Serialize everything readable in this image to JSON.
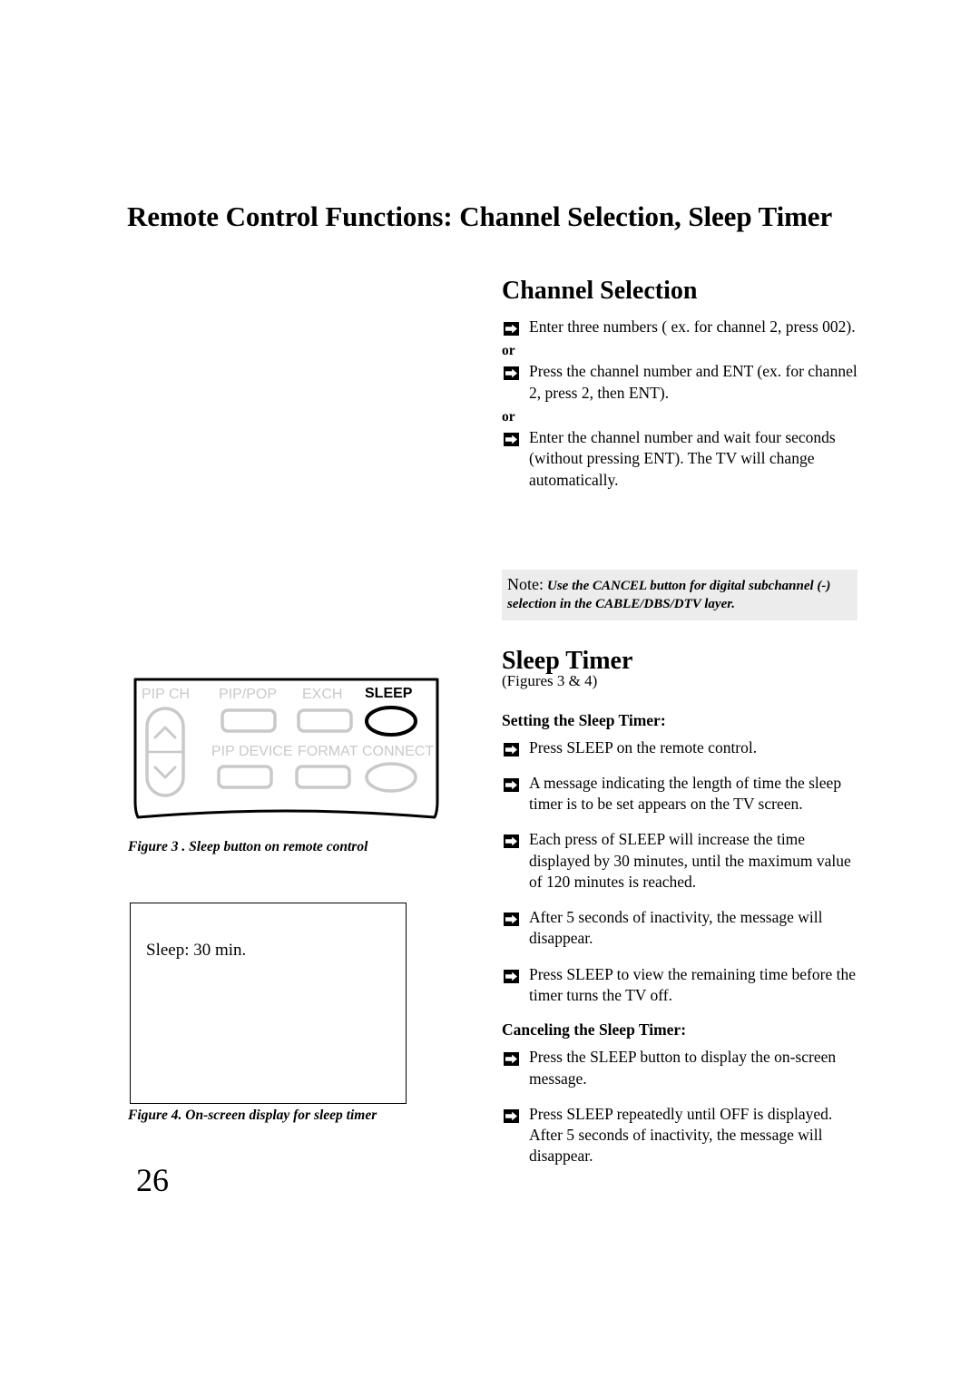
{
  "document": {
    "page_title": "Remote Control Functions: Channel Selection, Sleep Timer",
    "page_number": "26"
  },
  "channel_selection": {
    "heading": "Channel Selection",
    "bullets": [
      "Enter three numbers ( ex. for channel 2, press 002).",
      "Press the channel number and ENT (ex. for channel 2, press 2, then ENT).",
      "Enter the channel number and wait four seconds (without pressing ENT).  The TV will change automatically."
    ],
    "or_1": "or",
    "or_2": "or"
  },
  "note": {
    "label": "Note:",
    "text": "Use  the CANCEL button for digital subchannel (-) selection in the CABLE/DBS/DTV layer.",
    "background_color": "#ececec"
  },
  "sleep_timer": {
    "heading": "Sleep Timer",
    "figure_ref": "(Figures 3 & 4)",
    "setting_head": "Setting the Sleep Timer:",
    "setting_bullets": [
      "Press SLEEP on the remote control.",
      "A message indicating the length of time the sleep timer is to be set appears on the TV screen.",
      "Each press of SLEEP will increase the time displayed by 30 minutes, until the maximum value of 120 minutes is reached.",
      "After 5 seconds of inactivity, the message will disappear.",
      "Press SLEEP to view the remaining time before the timer turns the TV off."
    ],
    "canceling_head": "Canceling the Sleep Timer:",
    "canceling_bullets": [
      "Press the SLEEP button to display the on-screen message.",
      "Press SLEEP repeatedly until OFF is displayed. After 5 seconds of inactivity, the message will disappear."
    ]
  },
  "figure_3": {
    "caption": "Figure 3 . Sleep button on remote control",
    "buttons": {
      "pip_ch": "PIP CH",
      "pip_pop": "PIP/POP",
      "exch": "EXCH",
      "sleep": "SLEEP",
      "pip_device": "PIP DEVICE",
      "format": "FORMAT",
      "connect": "CONNECT"
    },
    "highlight_color": "#000000",
    "dim_color": "#c9c9c9"
  },
  "figure_4": {
    "caption": "Figure 4. On-screen display for sleep timer",
    "osd_message": "Sleep: 30 min."
  }
}
